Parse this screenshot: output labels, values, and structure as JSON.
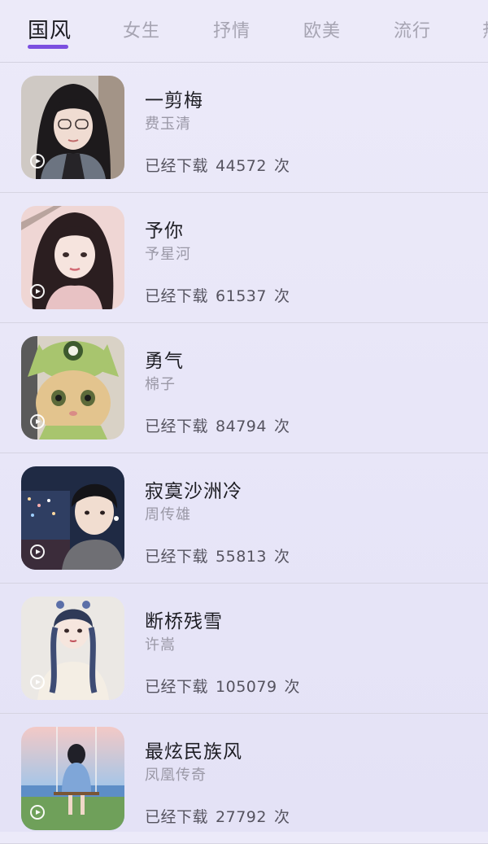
{
  "tabs": [
    {
      "label": "国风",
      "active": true
    },
    {
      "label": "女生",
      "active": false
    },
    {
      "label": "抒情",
      "active": false
    },
    {
      "label": "欧美",
      "active": false
    },
    {
      "label": "流行",
      "active": false
    },
    {
      "label": "热",
      "active": false
    }
  ],
  "colors": {
    "accent": "#7b4fe0",
    "background": "#eceaf9",
    "title_text": "#1e1e24",
    "secondary_text": "#9a98a6"
  },
  "songs": [
    {
      "title": "一剪梅",
      "artist": "费玉清",
      "downloads_prefix": "已经下载",
      "downloads": "44572",
      "downloads_suffix": "次",
      "cover": "girl-with-glasses-portrait",
      "icon": "play-circle-icon"
    },
    {
      "title": "予你",
      "artist": "予星河",
      "downloads_prefix": "已经下载",
      "downloads": "61537",
      "downloads_suffix": "次",
      "cover": "girl-portrait-pink",
      "icon": "play-circle-icon"
    },
    {
      "title": "勇气",
      "artist": "棉子",
      "downloads_prefix": "已经下载",
      "downloads": "84794",
      "downloads_suffix": "次",
      "cover": "cat-in-green-hat",
      "icon": "play-circle-icon"
    },
    {
      "title": "寂寞沙洲冷",
      "artist": "周传雄",
      "downloads_prefix": "已经下载",
      "downloads": "55813",
      "downloads_suffix": "次",
      "cover": "boy-night-city",
      "icon": "play-circle-icon"
    },
    {
      "title": "断桥残雪",
      "artist": "许嵩",
      "downloads_prefix": "已经下载",
      "downloads": "105079",
      "downloads_suffix": "次",
      "cover": "anime-girl-braids",
      "icon": "play-circle-icon"
    },
    {
      "title": "最炫民族风",
      "artist": "凤凰传奇",
      "downloads_prefix": "已经下载",
      "downloads": "27792",
      "downloads_suffix": "次",
      "cover": "girl-on-swing",
      "icon": "play-circle-icon"
    }
  ]
}
